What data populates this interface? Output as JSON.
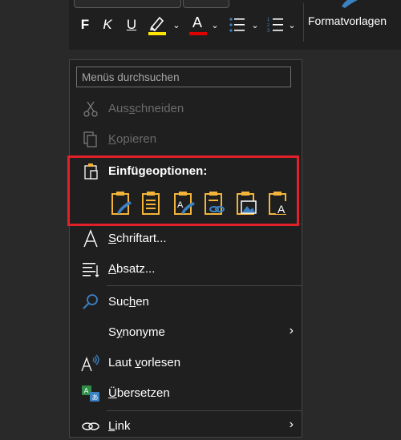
{
  "toolbar": {
    "bold": "F",
    "italic": "K",
    "underline": "U",
    "font_color_letter": "A",
    "styles_label": "Formatvorlagen",
    "highlight_color": "#ffe600",
    "font_color": "#e00000"
  },
  "menu": {
    "search_placeholder": "Menüs durchsuchen",
    "items": [
      {
        "id": "cut",
        "pre": "Aus",
        "ul": "s",
        "post": "chneiden",
        "disabled": true
      },
      {
        "id": "copy",
        "pre": "",
        "ul": "K",
        "post": "opieren",
        "disabled": true
      },
      {
        "id": "paste_options",
        "label": "Einfügeoptionen:",
        "bold": true
      },
      {
        "id": "font",
        "pre": "",
        "ul": "S",
        "post": "chriftart..."
      },
      {
        "id": "paragraph",
        "pre": "",
        "ul": "A",
        "post": "bsatz..."
      },
      {
        "id": "search",
        "pre": "Suc",
        "ul": "h",
        "post": "en"
      },
      {
        "id": "synonyms",
        "pre": "S",
        "ul": "y",
        "post": "nonyme",
        "submenu": true
      },
      {
        "id": "read_aloud",
        "pre": "Laut ",
        "ul": "v",
        "post": "orlesen"
      },
      {
        "id": "translate",
        "pre": "",
        "ul": "Ü",
        "post": "bersetzen"
      },
      {
        "id": "link",
        "pre": "",
        "ul": "L",
        "post": "ink",
        "submenu": true
      }
    ],
    "paste_option_icons": [
      "keep-source-formatting-icon",
      "merge-formatting-icon",
      "use-destination-styles-icon",
      "link-paste-icon",
      "picture-paste-icon",
      "keep-text-only-icon"
    ]
  },
  "colors": {
    "highlight_frame": "#e0212a",
    "clipboard": "#f4b43a",
    "accent_blue": "#3b82c4"
  }
}
